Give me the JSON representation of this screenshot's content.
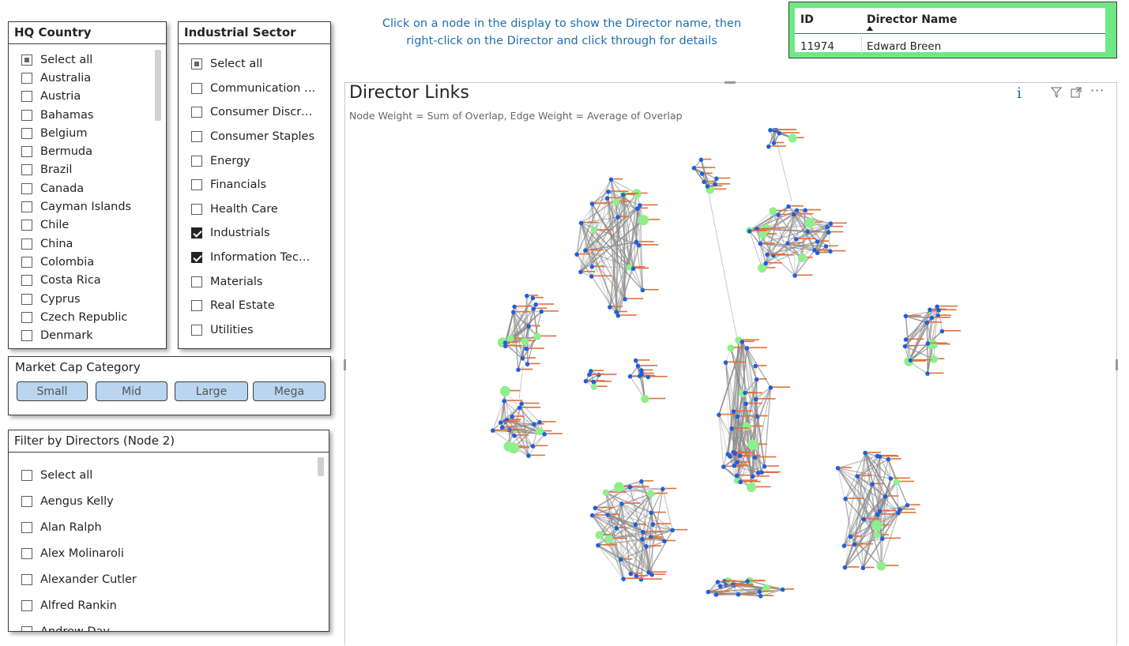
{
  "hq_country": {
    "title": "HQ Country",
    "items": [
      {
        "label": "Select all",
        "state": "partial"
      },
      {
        "label": "Australia",
        "state": "unchecked"
      },
      {
        "label": "Austria",
        "state": "unchecked"
      },
      {
        "label": "Bahamas",
        "state": "unchecked"
      },
      {
        "label": "Belgium",
        "state": "unchecked"
      },
      {
        "label": "Bermuda",
        "state": "unchecked"
      },
      {
        "label": "Brazil",
        "state": "unchecked"
      },
      {
        "label": "Canada",
        "state": "unchecked"
      },
      {
        "label": "Cayman Islands",
        "state": "unchecked"
      },
      {
        "label": "Chile",
        "state": "unchecked"
      },
      {
        "label": "China",
        "state": "unchecked"
      },
      {
        "label": "Colombia",
        "state": "unchecked"
      },
      {
        "label": "Costa Rica",
        "state": "unchecked"
      },
      {
        "label": "Cyprus",
        "state": "unchecked"
      },
      {
        "label": "Czech Republic",
        "state": "unchecked"
      },
      {
        "label": "Denmark",
        "state": "unchecked"
      }
    ]
  },
  "industrial_sector": {
    "title": "Industrial Sector",
    "items": [
      {
        "label": "Select all",
        "state": "partial"
      },
      {
        "label": "Communication S...",
        "state": "unchecked"
      },
      {
        "label": "Consumer Discreti...",
        "state": "unchecked"
      },
      {
        "label": "Consumer Staples",
        "state": "unchecked"
      },
      {
        "label": "Energy",
        "state": "unchecked"
      },
      {
        "label": "Financials",
        "state": "unchecked"
      },
      {
        "label": "Health Care",
        "state": "unchecked"
      },
      {
        "label": "Industrials",
        "state": "checked"
      },
      {
        "label": "Information Techn...",
        "state": "checked"
      },
      {
        "label": "Materials",
        "state": "unchecked"
      },
      {
        "label": "Real Estate",
        "state": "unchecked"
      },
      {
        "label": "Utilities",
        "state": "unchecked"
      }
    ]
  },
  "market_cap": {
    "title": "Market Cap Category",
    "buttons": [
      "Small",
      "Mid",
      "Large",
      "Mega"
    ]
  },
  "directors_filter": {
    "title": "Filter by Directors (Node 2)",
    "items": [
      {
        "label": "Select all",
        "state": "unchecked"
      },
      {
        "label": "Aengus Kelly",
        "state": "unchecked"
      },
      {
        "label": "Alan Ralph",
        "state": "unchecked"
      },
      {
        "label": "Alex Molinaroli",
        "state": "unchecked"
      },
      {
        "label": "Alexander Cutler",
        "state": "unchecked"
      },
      {
        "label": "Alfred Rankin",
        "state": "unchecked"
      },
      {
        "label": "Andrew Day",
        "state": "unchecked"
      }
    ]
  },
  "instructions": {
    "line1": "Click on a node in the display to show the Director name, then",
    "line2": "right-click on the Director and click through for details"
  },
  "director_table": {
    "col_id": "ID",
    "col_name": "Director Name",
    "rows": [
      {
        "id": "11974",
        "name": "Edward Breen"
      }
    ]
  },
  "visual": {
    "title": "Director Links",
    "subtitle": "Node Weight = Sum of Overlap, Edge Weight = Average of Overlap",
    "info_icon": "info-icon",
    "filter_icon": "filter-icon",
    "focus_icon": "focus-mode-icon",
    "more_icon": "more-options-icon"
  },
  "colors": {
    "node_blue": "#1f5fdc",
    "node_green": "#8ef08a",
    "edge": "#8a8a8a",
    "label_orange": "#e0703a",
    "table_bg": "#6ee884",
    "button_bg": "#b9d5ef",
    "instruction_text": "#1f6fb2"
  }
}
